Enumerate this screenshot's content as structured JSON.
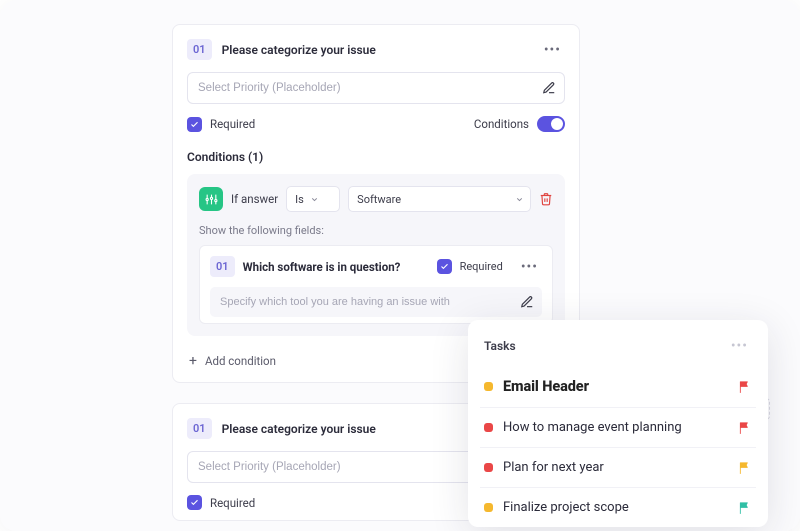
{
  "form": {
    "cards": [
      {
        "num": "01",
        "title": "Please categorize your issue",
        "placeholder": "Select Priority (Placeholder)",
        "required_label": "Required",
        "conditions_label": "Conditions",
        "conditions_count_label": "Conditions (1)",
        "condition": {
          "if_answer": "If answer",
          "op": "Is",
          "value": "Software",
          "show_label": "Show the following fields:",
          "nested": {
            "num": "01",
            "title": "Which software is in question?",
            "required": "Required",
            "placeholder": "Specify which tool you are having an issue with"
          }
        },
        "add_label": "Add condition"
      },
      {
        "num": "01",
        "title": "Please categorize your issue",
        "placeholder": "Select Priority (Placeholder)",
        "required_label": "Required"
      }
    ]
  },
  "tasks": {
    "title": "Tasks",
    "items": [
      {
        "label": "Email Header",
        "bullet": "b-yellow",
        "flag": "#ea4747",
        "hero": true
      },
      {
        "label": "How to manage event planning",
        "bullet": "b-red",
        "flag": "#ea4747"
      },
      {
        "label": "Plan for next year",
        "bullet": "b-red",
        "flag": "#f5b82e"
      },
      {
        "label": "Finalize project scope",
        "bullet": "b-yellow",
        "flag": "#30bfa5"
      }
    ]
  }
}
